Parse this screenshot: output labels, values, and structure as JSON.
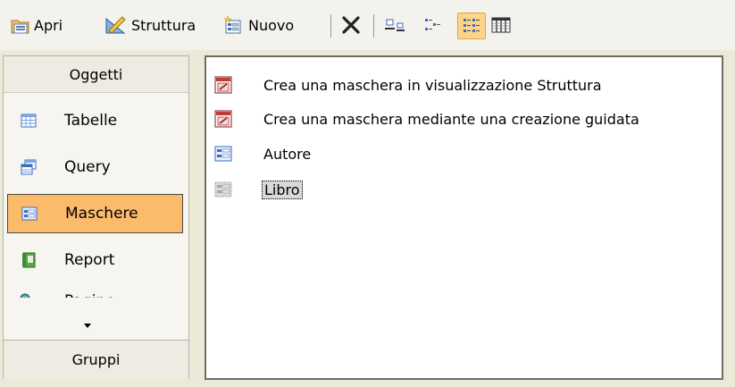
{
  "toolbar": {
    "open_label": "Apri",
    "design_label": "Struttura",
    "new_label": "Nuovo"
  },
  "objects_bar": {
    "header": "Oggetti",
    "items": [
      {
        "label": "Tabelle",
        "icon": "table-icon"
      },
      {
        "label": "Query",
        "icon": "query-icon"
      },
      {
        "label": "Maschere",
        "icon": "form-icon",
        "selected": true
      },
      {
        "label": "Report",
        "icon": "report-icon"
      },
      {
        "label": "Pagine",
        "icon": "pages-icon"
      }
    ],
    "groups_label": "Gruppi"
  },
  "list": {
    "items": [
      {
        "label": "Crea una maschera in visualizzazione Struttura",
        "icon": "wizard-form-icon"
      },
      {
        "label": "Crea una maschera mediante una creazione guidata",
        "icon": "wizard-form-icon"
      },
      {
        "label": "Autore",
        "icon": "form-icon"
      },
      {
        "label": "Libro",
        "icon": "form-icon",
        "focused": true
      }
    ]
  },
  "colors": {
    "selected_background": "#fcba6b",
    "toolbar_active": "#fbd68a",
    "window_background": "#ece9d8"
  }
}
